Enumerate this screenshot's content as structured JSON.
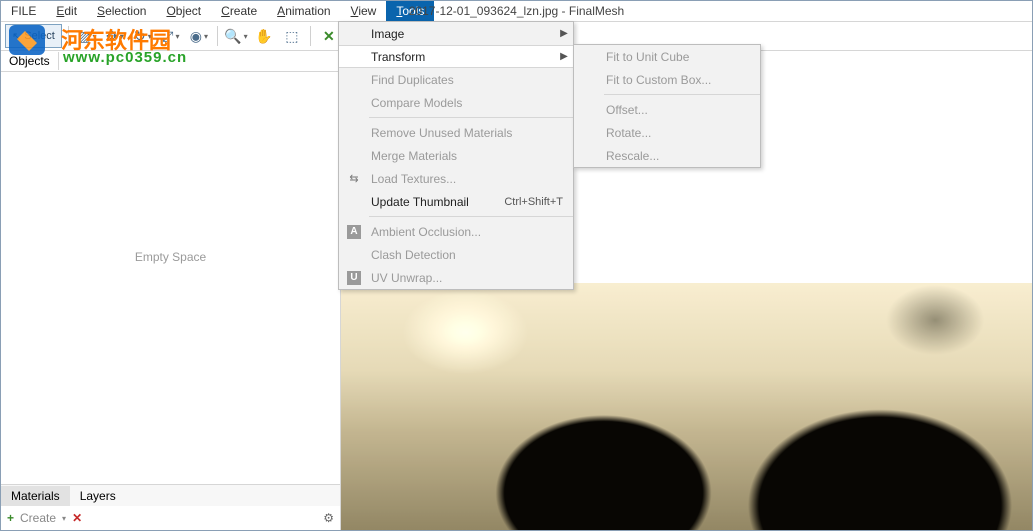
{
  "title": "2017-12-01_093624_lzn.jpg - FinalMesh",
  "menubar": [
    "FILE",
    "Edit",
    "Selection",
    "Object",
    "Create",
    "Animation",
    "View",
    "Tools"
  ],
  "menubar_active_index": 7,
  "toolbar": {
    "select_label": "Select"
  },
  "left_panel": {
    "top_tab": "Objects",
    "empty_text": "Empty Space",
    "bottom_tabs": [
      "Materials",
      "Layers"
    ],
    "bottom_active": 0,
    "footer_create": "Create"
  },
  "tools_menu": {
    "items": [
      {
        "label": "Image",
        "enabled": true,
        "submenu": true,
        "kind": "item"
      },
      {
        "label": "Transform",
        "enabled": true,
        "submenu": true,
        "kind": "item",
        "selected": true
      },
      {
        "label": "Find Duplicates",
        "enabled": false,
        "kind": "item"
      },
      {
        "label": "Compare Models",
        "enabled": false,
        "kind": "item"
      },
      {
        "kind": "sep"
      },
      {
        "label": "Remove Unused Materials",
        "enabled": false,
        "kind": "item"
      },
      {
        "label": "Merge Materials",
        "enabled": false,
        "kind": "item"
      },
      {
        "label": "Load Textures...",
        "enabled": false,
        "kind": "item",
        "icon": "load-textures"
      },
      {
        "label": "Update Thumbnail",
        "enabled": true,
        "shortcut": "Ctrl+Shift+T",
        "kind": "item"
      },
      {
        "kind": "sep"
      },
      {
        "label": "Ambient Occlusion...",
        "enabled": false,
        "kind": "item",
        "icon": "A"
      },
      {
        "label": "Clash Detection",
        "enabled": false,
        "kind": "item"
      },
      {
        "label": "UV Unwrap...",
        "enabled": false,
        "kind": "item",
        "icon": "U"
      }
    ]
  },
  "transform_submenu": {
    "items": [
      {
        "label": "Fit to Unit Cube",
        "kind": "item"
      },
      {
        "label": "Fit to Custom Box...",
        "kind": "item"
      },
      {
        "kind": "sep"
      },
      {
        "label": "Offset...",
        "kind": "item"
      },
      {
        "label": "Rotate...",
        "kind": "item"
      },
      {
        "label": "Rescale...",
        "kind": "item"
      }
    ]
  },
  "watermark": {
    "text1": "河东软件园",
    "text2": "www.pc0359.cn"
  }
}
